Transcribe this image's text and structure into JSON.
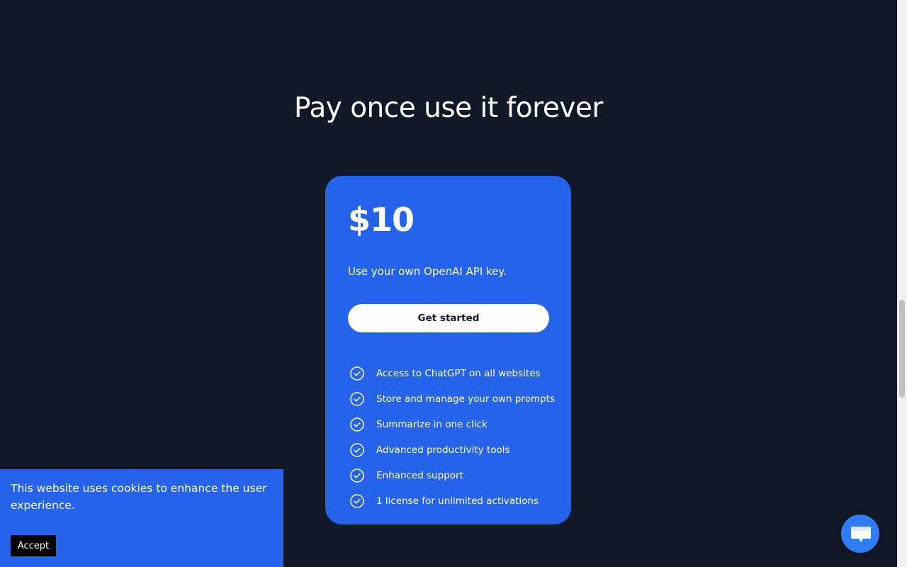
{
  "pricing": {
    "heading": "Pay once use it forever",
    "price": "$10",
    "description": "Use your own OpenAI API key.",
    "cta_label": "Get started",
    "features": [
      "Access to ChatGPT on all websites",
      "Store and manage your own prompts",
      "Summarize in one click",
      "Advanced productivity tools",
      "Enhanced support",
      "1 license for unlimited activations"
    ]
  },
  "cookie_banner": {
    "text": "This website uses cookies to enhance the user experience.",
    "accept_label": "Accept"
  },
  "icons": {
    "feature": "check-circle-icon",
    "chat": "chat-bubble-icon"
  },
  "colors": {
    "background": "#111827",
    "accent": "#2563eb",
    "chat_button": "#2f7cf6"
  }
}
